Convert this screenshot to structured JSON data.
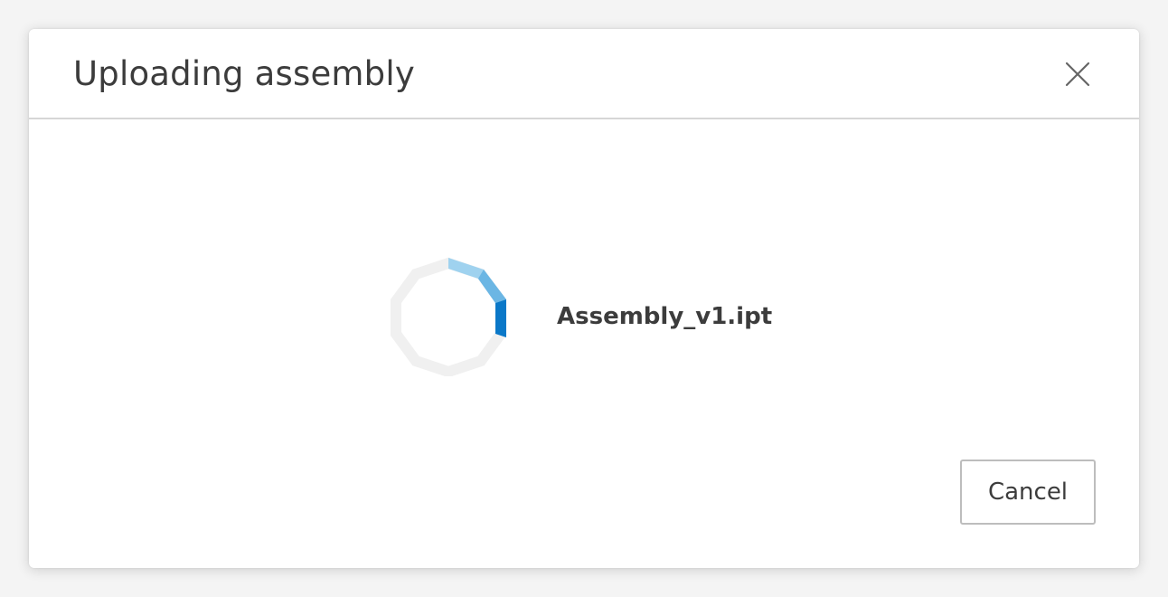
{
  "dialog": {
    "title": "Uploading assembly",
    "close_icon": "close-icon",
    "file_name": "Assembly_v1.ipt",
    "spinner_icon": "loading-spinner-icon",
    "cancel_label": "Cancel"
  },
  "colors": {
    "title_text": "#3c3c3c",
    "divider": "#d6d6d6",
    "spinner_track": "#f0f0f0",
    "spinner_accent": "#0a78c8",
    "spinner_accent_light": "#8cc8ec",
    "button_border": "#bdbdbd"
  }
}
